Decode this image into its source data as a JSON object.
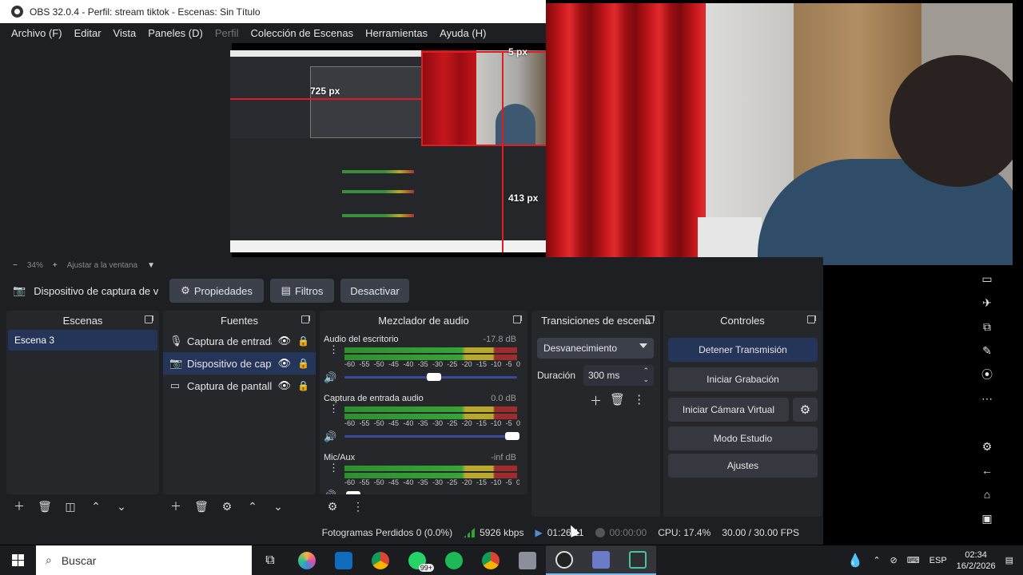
{
  "window": {
    "title": "OBS 32.0.4 - Perfil: stream tiktok - Escenas: Sin Título"
  },
  "menu": [
    "Archivo (F)",
    "Editar",
    "Vista",
    "Paneles (D)",
    "Perfil",
    "Colección de Escenas",
    "Herramientas",
    "Ayuda (H)"
  ],
  "preview": {
    "label_top": "5 px",
    "label_left": "725 px",
    "label_right": "413 px"
  },
  "zoombar": {
    "minus": "−",
    "zoom": "34%",
    "plus": "+",
    "fit": "Ajustar a la ventana"
  },
  "source_toolbar": {
    "current_source": "Dispositivo de captura de v",
    "properties": "Propiedades",
    "filters": "Filtros",
    "deactivate": "Desactivar"
  },
  "docks": {
    "scenes": "Escenas",
    "sources": "Fuentes",
    "mixer": "Mezclador de audio",
    "transitions": "Transiciones de escena",
    "controls": "Controles"
  },
  "scenes": [
    "Escena 3"
  ],
  "sources": [
    {
      "name": "Captura de entrada",
      "icon": "microphone-icon"
    },
    {
      "name": "Dispositivo de capt",
      "icon": "camera-icon"
    },
    {
      "name": "Captura de pantall",
      "icon": "monitor-icon"
    }
  ],
  "mixer": {
    "scale": [
      "-60",
      "-55",
      "-50",
      "-45",
      "-40",
      "-35",
      "-30",
      "-25",
      "-20",
      "-15",
      "-10",
      "-5",
      "0"
    ],
    "channels": [
      {
        "name": "Audio del escritorio",
        "db": "-17.8 dB",
        "volume": 0.52
      },
      {
        "name": "Captura de entrada audio",
        "db": "0.0 dB",
        "volume": 0.97
      },
      {
        "name": "Mic/Aux",
        "db": "-inf dB",
        "volume": 0.05
      }
    ]
  },
  "transitions": {
    "selected": "Desvanecimiento",
    "duration_label": "Duración",
    "duration": "300 ms"
  },
  "controls": {
    "stop_stream": "Detener Transmisión",
    "start_recording": "Iniciar Grabación",
    "start_virtual_cam": "Iniciar Cámara Virtual",
    "studio_mode": "Modo Estudio",
    "settings": "Ajustes"
  },
  "status": {
    "dropped": "Fotogramas Perdidos 0 (0.0%)",
    "bitrate": "5926 kbps",
    "stream_time": "01:26:11",
    "rec_time": "00:00:00",
    "cpu": "CPU: 17.4%",
    "fps": "30.00 / 30.00 FPS"
  },
  "taskbar": {
    "search": "Buscar",
    "whatsapp_badge": "99+",
    "lang": "ESP",
    "time": "02:34",
    "date": "16/2/2026"
  },
  "colors": {
    "accent": "#253459",
    "dock_bg": "#26272b",
    "app_bg": "#1e1f22",
    "guide_red": "#e01b24"
  }
}
